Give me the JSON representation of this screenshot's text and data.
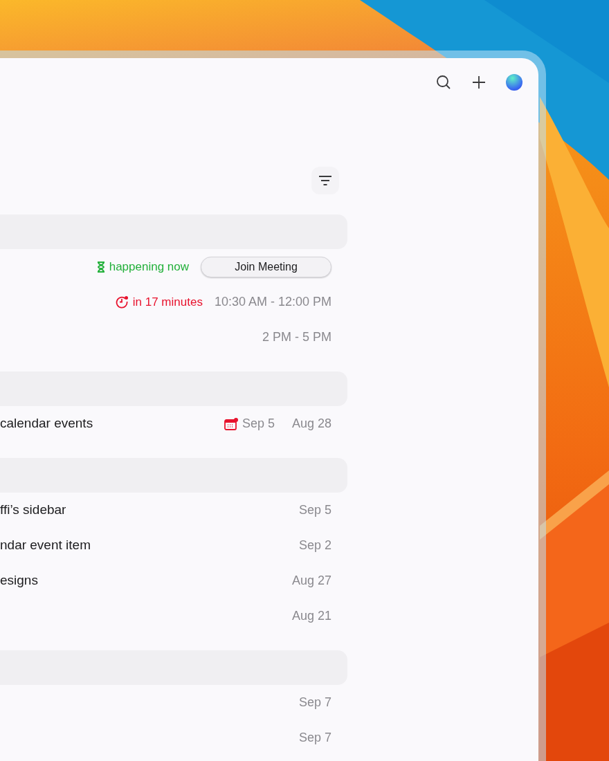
{
  "sections": [
    {
      "rows": [
        {
          "status": {
            "kind": "now",
            "text": "happening now"
          },
          "action": "Join Meeting"
        },
        {
          "status": {
            "kind": "soon",
            "text": "in 17 minutes"
          },
          "time": "10:30 AM - 12:00 PM"
        },
        {
          "time": "2 PM - 5 PM"
        }
      ]
    },
    {
      "rows": [
        {
          "title": "calendar events",
          "due": "Sep 5",
          "date": "Aug 28"
        }
      ]
    },
    {
      "rows": [
        {
          "title": "ffi’s sidebar",
          "date": "Sep 5"
        },
        {
          "title": "ndar event item",
          "date": "Sep 2"
        },
        {
          "title": "esigns",
          "date": "Aug 27"
        },
        {
          "date": "Aug 21"
        }
      ]
    },
    {
      "rows": [
        {
          "date": "Sep 7"
        },
        {
          "date": "Sep 7"
        }
      ]
    }
  ]
}
